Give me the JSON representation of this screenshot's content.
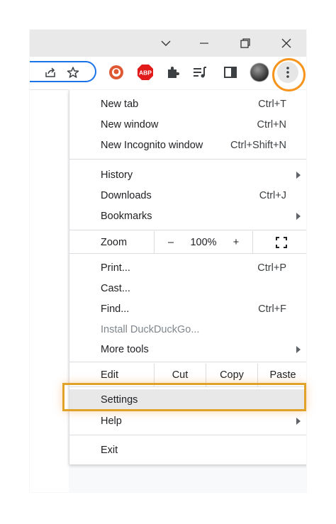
{
  "window_controls": {
    "tabs_dropdown_icon": "chevron-down-icon",
    "minimize_icon": "minimize-icon",
    "restore_icon": "restore-icon",
    "close_icon": "close-icon"
  },
  "toolbar": {
    "share_icon": "share-icon",
    "bookmark_icon": "star-icon",
    "extensions": [
      {
        "name": "duckduckgo-icon",
        "color": "#de5833"
      },
      {
        "name": "adblock-plus-icon",
        "text": "ABP",
        "color": "#e11a1a"
      },
      {
        "name": "puzzle-icon",
        "color": "#3c4043"
      },
      {
        "name": "reading-list-icon",
        "color": "#3c4043"
      },
      {
        "name": "side-panel-icon",
        "color": "#3c4043"
      }
    ],
    "menu_icon": "three-dots-icon",
    "accent": "#1a73e8"
  },
  "menu": {
    "new_tab": {
      "label": "New tab",
      "shortcut": "Ctrl+T"
    },
    "new_window": {
      "label": "New window",
      "shortcut": "Ctrl+N"
    },
    "new_incognito": {
      "label": "New Incognito window",
      "shortcut": "Ctrl+Shift+N"
    },
    "history": {
      "label": "History"
    },
    "downloads": {
      "label": "Downloads",
      "shortcut": "Ctrl+J"
    },
    "bookmarks": {
      "label": "Bookmarks"
    },
    "zoom": {
      "label": "Zoom",
      "minus": "–",
      "value": "100%",
      "plus": "+",
      "fullscreen_icon": "fullscreen-icon"
    },
    "print": {
      "label": "Print...",
      "shortcut": "Ctrl+P"
    },
    "cast": {
      "label": "Cast..."
    },
    "find": {
      "label": "Find...",
      "shortcut": "Ctrl+F"
    },
    "install": {
      "label": "Install DuckDuckGo..."
    },
    "more_tools": {
      "label": "More tools"
    },
    "edit": {
      "label": "Edit",
      "cut": "Cut",
      "copy": "Copy",
      "paste": "Paste"
    },
    "settings": {
      "label": "Settings"
    },
    "help": {
      "label": "Help"
    },
    "exit": {
      "label": "Exit"
    }
  },
  "highlight_colors": {
    "settings_box": "#e0a228",
    "menu_button_circle": "#f7941d"
  }
}
